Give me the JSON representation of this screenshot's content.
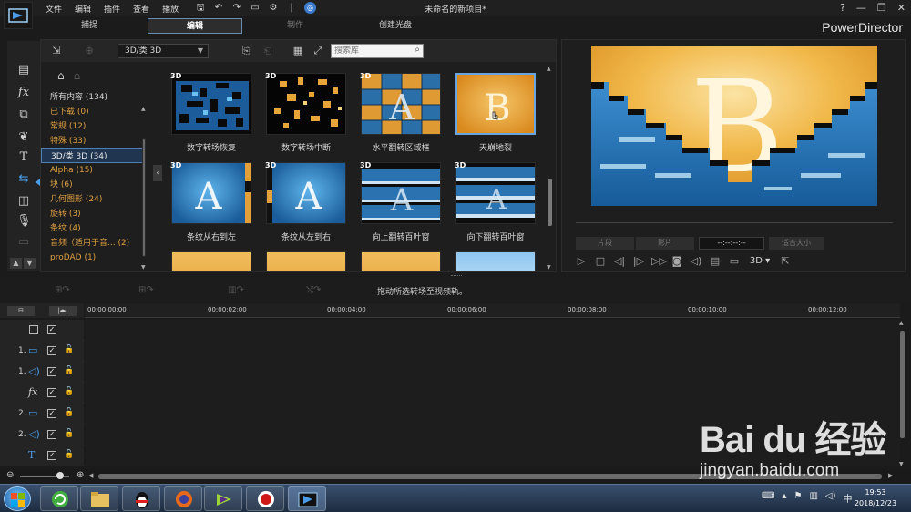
{
  "window": {
    "title": "未命名的新项目*",
    "menu": [
      "文件",
      "编辑",
      "插件",
      "查看",
      "播放"
    ],
    "help": "?",
    "minimize": "—",
    "restore": "❐",
    "close": "✕"
  },
  "modes": {
    "capture": "捕捉",
    "edit": "编辑",
    "produce": "制作",
    "disc": "创建光盘"
  },
  "brand": "PowerDirector",
  "library": {
    "category_select": "3D/类 3D",
    "search_placeholder": "搜索库",
    "categories": [
      {
        "label": "所有内容 (134)"
      },
      {
        "label": "已下载  (0)"
      },
      {
        "label": "常规  (12)"
      },
      {
        "label": "特殊  (33)"
      },
      {
        "label": "3D/类 3D  (34)"
      },
      {
        "label": "Alpha  (15)"
      },
      {
        "label": "块  (6)"
      },
      {
        "label": "几何图形  (24)"
      },
      {
        "label": "旋转  (3)"
      },
      {
        "label": "条纹  (4)"
      },
      {
        "label": "音频（适用于音...  (2)"
      },
      {
        "label": "proDAD  (1)"
      }
    ],
    "tag_3d": "3D",
    "transitions": [
      {
        "label": "数字转场恢复"
      },
      {
        "label": "数字转场中断"
      },
      {
        "label": "水平翻转区域框"
      },
      {
        "label": "天崩地裂"
      },
      {
        "label": "条纹从右到左"
      },
      {
        "label": "条纹从左到右"
      },
      {
        "label": "向上翻转百叶窗"
      },
      {
        "label": "向下翻转百叶窗"
      }
    ]
  },
  "preview": {
    "btn_clip": "片段",
    "btn_movie": "影片",
    "timecode": "--:--:--:--",
    "zoom": "适合大小",
    "mode_3d": "3D ▾"
  },
  "timeline": {
    "hint": "拖动所选转场至视频轨。",
    "ruler": [
      "00:00:00:00",
      "00:00:02:00",
      "00:00:04:00",
      "00:00:06:00",
      "00:00:08:00",
      "00:00:10:00",
      "00:00:12:00"
    ],
    "tracks": [
      {
        "num": "",
        "icon": "",
        "name": "master"
      },
      {
        "num": "1.",
        "icon": "▭",
        "name": "video-1"
      },
      {
        "num": "1.",
        "icon": "◁)",
        "name": "audio-1"
      },
      {
        "num": "",
        "icon": "fx",
        "name": "effect"
      },
      {
        "num": "2.",
        "icon": "▭",
        "name": "video-2"
      },
      {
        "num": "2.",
        "icon": "◁)",
        "name": "audio-2"
      },
      {
        "num": "",
        "icon": "T",
        "name": "title"
      }
    ]
  },
  "taskbar": {
    "time": "19:53",
    "date": "2018/12/23"
  },
  "watermark": {
    "logo": "Bai du 经验",
    "url": "jingyan.baidu.com"
  }
}
